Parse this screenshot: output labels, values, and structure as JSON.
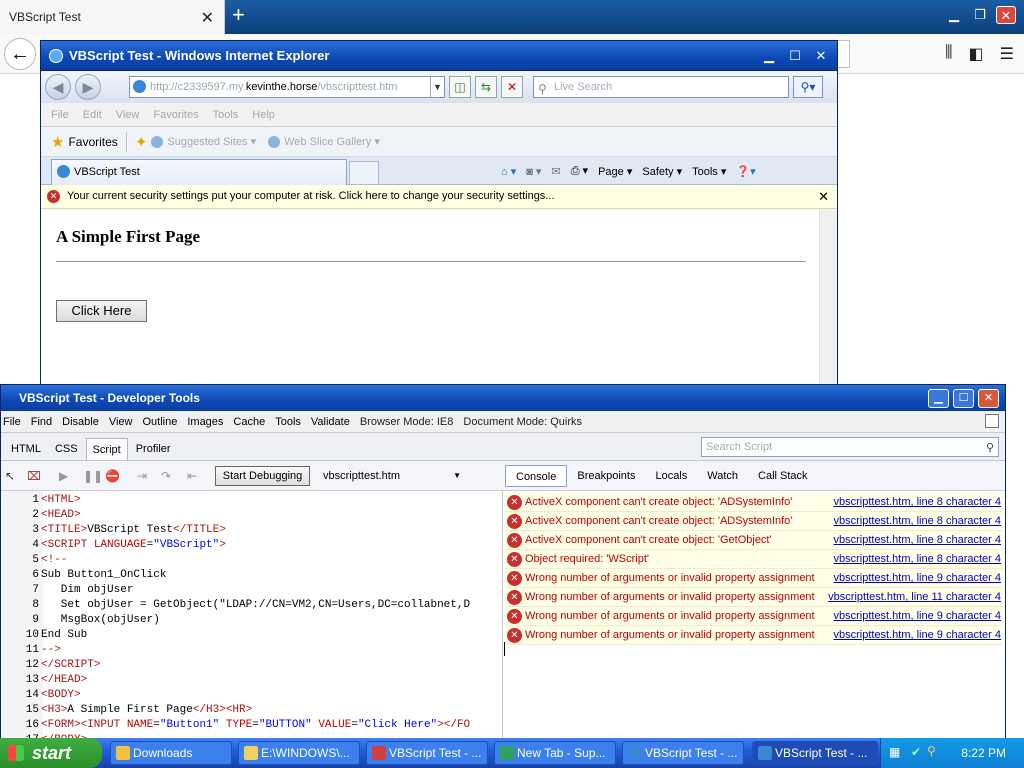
{
  "firefox": {
    "tab_title": "VBScript Test",
    "close_glyph": "✕",
    "newtab_glyph": "+",
    "back_glyph": "←"
  },
  "ie": {
    "title": "VBScript Test - Windows Internet Explorer",
    "address_prefix": "http://c2339597.my.",
    "address_domain": "kevinthe.horse",
    "address_suffix": "/vbscripttest.htm",
    "search_placeholder": "Live Search",
    "menu": [
      "File",
      "Edit",
      "View",
      "Favorites",
      "Tools",
      "Help"
    ],
    "favorites_label": "Favorites",
    "suggested_sites": "Suggested Sites",
    "web_slice": "Web Slice Gallery",
    "tab_title": "VBScript Test",
    "commands": {
      "page": "Page",
      "safety": "Safety",
      "tools": "Tools"
    },
    "info_bar": "Your current security settings put your computer at risk. Click here to change your security settings...",
    "page_heading": "A Simple First Page",
    "page_button": "Click Here"
  },
  "devtools": {
    "title": "VBScript Test - Developer Tools",
    "menu": [
      "File",
      "Find",
      "Disable",
      "View",
      "Outline",
      "Images",
      "Cache",
      "Tools",
      "Validate"
    ],
    "browser_mode": "Browser Mode: IE8",
    "document_mode": "Document Mode: Quirks",
    "tabs": [
      "HTML",
      "CSS",
      "Script",
      "Profiler"
    ],
    "search_placeholder": "Search Script",
    "start_debugging": "Start Debugging",
    "file_select": "vbscripttest.htm",
    "right_tabs": [
      "Console",
      "Breakpoints",
      "Locals",
      "Watch",
      "Call Stack"
    ],
    "code_lines": [
      {
        "n": "1",
        "html": "<span class=\"tag\">&lt;HTML&gt;</span>"
      },
      {
        "n": "2",
        "html": "<span class=\"tag\">&lt;HEAD&gt;</span>"
      },
      {
        "n": "3",
        "html": "<span class=\"tag\">&lt;TITLE&gt;</span>VBScript Test<span class=\"tag\">&lt;/TITLE&gt;</span>"
      },
      {
        "n": "4",
        "html": "<span class=\"tag\">&lt;SCRIPT</span> <span class=\"attr\">LANGUAGE</span>=<span class=\"val\">\"VBScript\"</span><span class=\"tag\">&gt;</span>"
      },
      {
        "n": "5",
        "html": "<span class=\"tag\">&lt;!--</span>"
      },
      {
        "n": "6",
        "html": "Sub Button1_OnClick"
      },
      {
        "n": "7",
        "html": "   Dim objUser"
      },
      {
        "n": "8",
        "html": "   Set objUser = GetObject(\"LDAP://CN=VM2,CN=Users,DC=collabnet,D"
      },
      {
        "n": "9",
        "html": "   MsgBox(objUser)"
      },
      {
        "n": "10",
        "html": "End Sub"
      },
      {
        "n": "11",
        "html": "<span class=\"tag\">--&gt;</span>"
      },
      {
        "n": "12",
        "html": "<span class=\"tag\">&lt;/SCRIPT&gt;</span>"
      },
      {
        "n": "13",
        "html": "<span class=\"tag\">&lt;/HEAD&gt;</span>"
      },
      {
        "n": "14",
        "html": "<span class=\"tag\">&lt;BODY&gt;</span>"
      },
      {
        "n": "15",
        "html": "<span class=\"tag\">&lt;H3&gt;</span>A Simple First Page<span class=\"tag\">&lt;/H3&gt;&lt;HR&gt;</span>"
      },
      {
        "n": "16",
        "html": "<span class=\"tag\">&lt;FORM&gt;&lt;INPUT</span> <span class=\"attr\">NAME</span>=<span class=\"val\">\"Button1\"</span> <span class=\"attr\">TYPE</span>=<span class=\"val\">\"BUTTON\"</span> <span class=\"attr\">VALUE</span>=<span class=\"val\">\"Click Here\"</span><span class=\"tag\">&gt;&lt;/FO</span>"
      },
      {
        "n": "17",
        "html": "<span class=\"tag\">&lt;/BODY&gt;</span>"
      }
    ],
    "console": [
      {
        "msg": "ActiveX component can't create object: 'ADSystemInfo'",
        "loc": "vbscripttest.htm, line 8 character 4"
      },
      {
        "msg": "ActiveX component can't create object: 'ADSystemInfo'",
        "loc": "vbscripttest.htm, line 8 character 4"
      },
      {
        "msg": "ActiveX component can't create object: 'GetObject'",
        "loc": "vbscripttest.htm, line 8 character 4"
      },
      {
        "msg": "Object required: 'WScript'",
        "loc": "vbscripttest.htm, line 8 character 4"
      },
      {
        "msg": "Wrong number of arguments or invalid property assignment",
        "loc": "vbscripttest.htm, line 9 character 4"
      },
      {
        "msg": "Wrong number of arguments or invalid property assignment",
        "loc": "vbscripttest.htm, line 11 character 4"
      },
      {
        "msg": "Wrong number of arguments or invalid property assignment",
        "loc": "vbscripttest.htm, line 9 character 4"
      },
      {
        "msg": "Wrong number of arguments or invalid property assignment",
        "loc": "vbscripttest.htm, line 9 character 4"
      }
    ]
  },
  "taskbar": {
    "start": "start",
    "items": [
      {
        "label": "Downloads",
        "icon_color": "#f0c040",
        "active": false
      },
      {
        "label": "E:\\WINDOWS\\...",
        "icon_color": "#f0d060",
        "active": false
      },
      {
        "label": "VBScript Test - ...",
        "icon_color": "#d04040",
        "active": false
      },
      {
        "label": "New Tab - Sup...",
        "icon_color": "#30a060",
        "active": false
      },
      {
        "label": "VBScript Test - ...",
        "icon_color": "#3b86d6",
        "active": false
      },
      {
        "label": "VBScript Test - ...",
        "icon_color": "#3b86d6",
        "active": true
      }
    ],
    "time": "8:22 PM"
  }
}
